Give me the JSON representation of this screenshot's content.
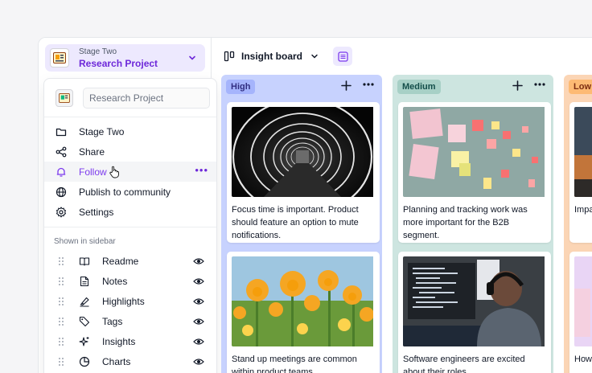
{
  "project": {
    "stage": "Stage Two",
    "name": "Research Project"
  },
  "menu": {
    "search_value": "Research Project",
    "items": [
      {
        "label": "Stage Two",
        "icon": "folder-icon"
      },
      {
        "label": "Share",
        "icon": "share-icon"
      },
      {
        "label": "Follow",
        "icon": "bell-icon",
        "active": true
      },
      {
        "label": "Publish to community",
        "icon": "globe-icon"
      },
      {
        "label": "Settings",
        "icon": "gear-icon"
      }
    ],
    "section_label": "Shown in sidebar",
    "sidebar_items": [
      {
        "label": "Readme",
        "icon": "book-icon"
      },
      {
        "label": "Notes",
        "icon": "notes-icon"
      },
      {
        "label": "Highlights",
        "icon": "highlighter-icon"
      },
      {
        "label": "Tags",
        "icon": "tag-icon"
      },
      {
        "label": "Insights",
        "icon": "sparkle-icon"
      },
      {
        "label": "Charts",
        "icon": "pie-chart-icon"
      }
    ]
  },
  "toolbar": {
    "board_name": "Insight board"
  },
  "columns": [
    {
      "tag": "High",
      "cards": [
        {
          "text": "Focus time is important. Product should feature an option to mute notifications.",
          "image": "tunnel-photo"
        },
        {
          "text": "Stand up meetings are common within product teams",
          "image": "flowers-photo"
        }
      ]
    },
    {
      "tag": "Medium",
      "cards": [
        {
          "text": "Planning and tracking work was more important for the B2B segment.",
          "image": "sticky-notes-photo"
        },
        {
          "text": "Software engineers are excited about their roles",
          "image": "engineer-photo"
        }
      ]
    },
    {
      "tag": "Low",
      "cards": [
        {
          "text": "Impa... with ... Mes...",
          "image": "landscape-photo"
        },
        {
          "text": "How... Reta...",
          "image": "room-photo"
        }
      ]
    }
  ],
  "colors": {
    "accent": "#7c3aed",
    "high": "#c7d2fe",
    "medium": "#cde5e0",
    "low": "#fbd5b5"
  }
}
